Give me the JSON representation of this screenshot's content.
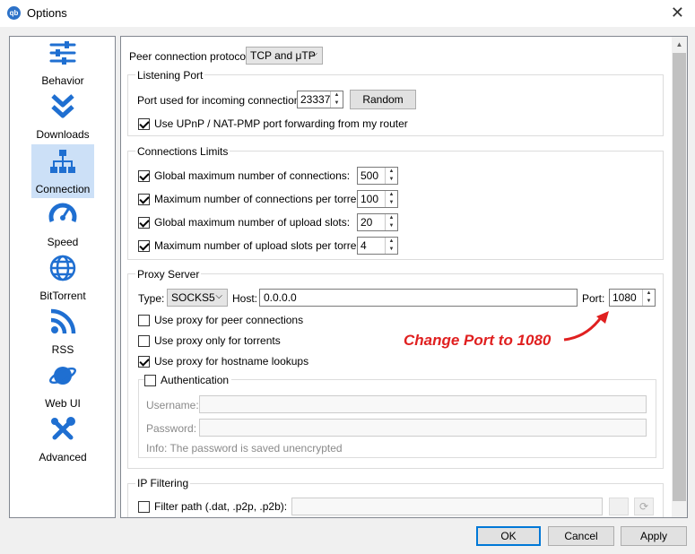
{
  "window": {
    "title": "Options",
    "app_icon_text": "qb"
  },
  "sidebar": {
    "items": [
      {
        "label": "Behavior",
        "icon": "sliders-icon",
        "selected": false
      },
      {
        "label": "Downloads",
        "icon": "double-chevron-down-icon",
        "selected": false
      },
      {
        "label": "Connection",
        "icon": "network-icon",
        "selected": true
      },
      {
        "label": "Speed",
        "icon": "speedometer-icon",
        "selected": false
      },
      {
        "label": "BitTorrent",
        "icon": "globe-icon",
        "selected": false
      },
      {
        "label": "RSS",
        "icon": "rss-icon",
        "selected": false
      },
      {
        "label": "Web UI",
        "icon": "planet-icon",
        "selected": false
      },
      {
        "label": "Advanced",
        "icon": "tools-icon",
        "selected": false
      }
    ]
  },
  "connection": {
    "protocol_label": "Peer connection protocol:",
    "protocol_value": "TCP and μTP",
    "listening_port": {
      "title": "Listening Port",
      "port_label": "Port used for incoming connections:",
      "port_value": "23337",
      "random_button": "Random",
      "upnp_label": "Use UPnP / NAT-PMP port forwarding from my router",
      "upnp_checked": true
    },
    "limits": {
      "title": "Connections Limits",
      "rows": [
        {
          "label": "Global maximum number of connections:",
          "value": "500",
          "checked": true
        },
        {
          "label": "Maximum number of connections per torrent:",
          "value": "100",
          "checked": true
        },
        {
          "label": "Global maximum number of upload slots:",
          "value": "20",
          "checked": true
        },
        {
          "label": "Maximum number of upload slots per torrent:",
          "value": "4",
          "checked": true
        }
      ]
    },
    "proxy": {
      "title": "Proxy Server",
      "type_label": "Type:",
      "type_value": "SOCKS5",
      "host_label": "Host:",
      "host_value": "0.0.0.0",
      "port_label": "Port:",
      "port_value": "1080",
      "options": [
        {
          "label": "Use proxy for peer connections",
          "checked": false
        },
        {
          "label": "Use proxy only for torrents",
          "checked": false
        },
        {
          "label": "Use proxy for hostname lookups",
          "checked": true
        }
      ],
      "auth": {
        "label": "Authentication",
        "checked": false,
        "username_label": "Username:",
        "password_label": "Password:",
        "info": "Info: The password is saved unencrypted"
      }
    },
    "ip_filtering": {
      "title": "IP Filtering",
      "filter_label": "Filter path (.dat, .p2p, .p2b):",
      "checked": false
    }
  },
  "annotation": {
    "text": "Change Port to 1080",
    "color": "#e02020"
  },
  "buttons": {
    "ok": "OK",
    "cancel": "Cancel",
    "apply": "Apply"
  }
}
